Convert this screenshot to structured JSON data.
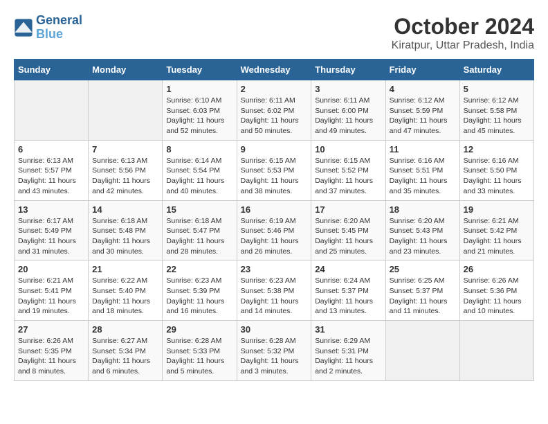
{
  "logo": {
    "line1": "General",
    "line2": "Blue"
  },
  "title": "October 2024",
  "subtitle": "Kiratpur, Uttar Pradesh, India",
  "headers": [
    "Sunday",
    "Monday",
    "Tuesday",
    "Wednesday",
    "Thursday",
    "Friday",
    "Saturday"
  ],
  "weeks": [
    [
      {
        "day": "",
        "info": ""
      },
      {
        "day": "",
        "info": ""
      },
      {
        "day": "1",
        "info": "Sunrise: 6:10 AM\nSunset: 6:03 PM\nDaylight: 11 hours and 52 minutes."
      },
      {
        "day": "2",
        "info": "Sunrise: 6:11 AM\nSunset: 6:02 PM\nDaylight: 11 hours and 50 minutes."
      },
      {
        "day": "3",
        "info": "Sunrise: 6:11 AM\nSunset: 6:00 PM\nDaylight: 11 hours and 49 minutes."
      },
      {
        "day": "4",
        "info": "Sunrise: 6:12 AM\nSunset: 5:59 PM\nDaylight: 11 hours and 47 minutes."
      },
      {
        "day": "5",
        "info": "Sunrise: 6:12 AM\nSunset: 5:58 PM\nDaylight: 11 hours and 45 minutes."
      }
    ],
    [
      {
        "day": "6",
        "info": "Sunrise: 6:13 AM\nSunset: 5:57 PM\nDaylight: 11 hours and 43 minutes."
      },
      {
        "day": "7",
        "info": "Sunrise: 6:13 AM\nSunset: 5:56 PM\nDaylight: 11 hours and 42 minutes."
      },
      {
        "day": "8",
        "info": "Sunrise: 6:14 AM\nSunset: 5:54 PM\nDaylight: 11 hours and 40 minutes."
      },
      {
        "day": "9",
        "info": "Sunrise: 6:15 AM\nSunset: 5:53 PM\nDaylight: 11 hours and 38 minutes."
      },
      {
        "day": "10",
        "info": "Sunrise: 6:15 AM\nSunset: 5:52 PM\nDaylight: 11 hours and 37 minutes."
      },
      {
        "day": "11",
        "info": "Sunrise: 6:16 AM\nSunset: 5:51 PM\nDaylight: 11 hours and 35 minutes."
      },
      {
        "day": "12",
        "info": "Sunrise: 6:16 AM\nSunset: 5:50 PM\nDaylight: 11 hours and 33 minutes."
      }
    ],
    [
      {
        "day": "13",
        "info": "Sunrise: 6:17 AM\nSunset: 5:49 PM\nDaylight: 11 hours and 31 minutes."
      },
      {
        "day": "14",
        "info": "Sunrise: 6:18 AM\nSunset: 5:48 PM\nDaylight: 11 hours and 30 minutes."
      },
      {
        "day": "15",
        "info": "Sunrise: 6:18 AM\nSunset: 5:47 PM\nDaylight: 11 hours and 28 minutes."
      },
      {
        "day": "16",
        "info": "Sunrise: 6:19 AM\nSunset: 5:46 PM\nDaylight: 11 hours and 26 minutes."
      },
      {
        "day": "17",
        "info": "Sunrise: 6:20 AM\nSunset: 5:45 PM\nDaylight: 11 hours and 25 minutes."
      },
      {
        "day": "18",
        "info": "Sunrise: 6:20 AM\nSunset: 5:43 PM\nDaylight: 11 hours and 23 minutes."
      },
      {
        "day": "19",
        "info": "Sunrise: 6:21 AM\nSunset: 5:42 PM\nDaylight: 11 hours and 21 minutes."
      }
    ],
    [
      {
        "day": "20",
        "info": "Sunrise: 6:21 AM\nSunset: 5:41 PM\nDaylight: 11 hours and 19 minutes."
      },
      {
        "day": "21",
        "info": "Sunrise: 6:22 AM\nSunset: 5:40 PM\nDaylight: 11 hours and 18 minutes."
      },
      {
        "day": "22",
        "info": "Sunrise: 6:23 AM\nSunset: 5:39 PM\nDaylight: 11 hours and 16 minutes."
      },
      {
        "day": "23",
        "info": "Sunrise: 6:23 AM\nSunset: 5:38 PM\nDaylight: 11 hours and 14 minutes."
      },
      {
        "day": "24",
        "info": "Sunrise: 6:24 AM\nSunset: 5:37 PM\nDaylight: 11 hours and 13 minutes."
      },
      {
        "day": "25",
        "info": "Sunrise: 6:25 AM\nSunset: 5:37 PM\nDaylight: 11 hours and 11 minutes."
      },
      {
        "day": "26",
        "info": "Sunrise: 6:26 AM\nSunset: 5:36 PM\nDaylight: 11 hours and 10 minutes."
      }
    ],
    [
      {
        "day": "27",
        "info": "Sunrise: 6:26 AM\nSunset: 5:35 PM\nDaylight: 11 hours and 8 minutes."
      },
      {
        "day": "28",
        "info": "Sunrise: 6:27 AM\nSunset: 5:34 PM\nDaylight: 11 hours and 6 minutes."
      },
      {
        "day": "29",
        "info": "Sunrise: 6:28 AM\nSunset: 5:33 PM\nDaylight: 11 hours and 5 minutes."
      },
      {
        "day": "30",
        "info": "Sunrise: 6:28 AM\nSunset: 5:32 PM\nDaylight: 11 hours and 3 minutes."
      },
      {
        "day": "31",
        "info": "Sunrise: 6:29 AM\nSunset: 5:31 PM\nDaylight: 11 hours and 2 minutes."
      },
      {
        "day": "",
        "info": ""
      },
      {
        "day": "",
        "info": ""
      }
    ]
  ]
}
